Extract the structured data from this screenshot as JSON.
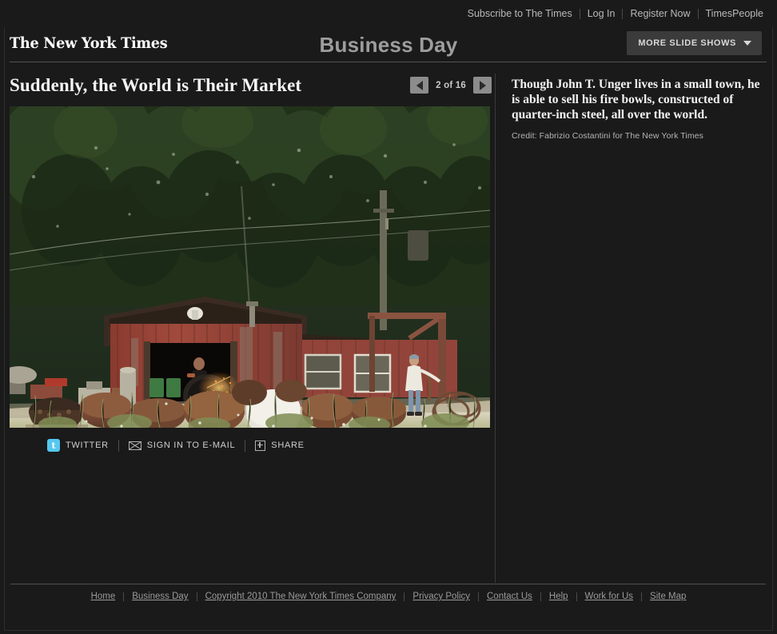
{
  "topbar": {
    "links": [
      {
        "label": "Subscribe to The Times"
      },
      {
        "label": "Log In"
      },
      {
        "label": "Register Now"
      },
      {
        "label": "TimesPeople"
      }
    ]
  },
  "masthead": {
    "logo": "The New York Times",
    "section_title": "Business Day",
    "more_slideshows_label": "MORE SLIDE SHOWS",
    "caret_icon": "chevron-down-icon"
  },
  "slideshow": {
    "headline": "Suddenly, the World is Their Market",
    "prev_icon": "arrow-left-icon",
    "next_icon": "arrow-right-icon",
    "counter": "2 of 16",
    "current_index": 2,
    "total_slides": 16
  },
  "share": {
    "twitter": {
      "label": "TWITTER",
      "icon": "twitter-icon",
      "color": "#55c8f0"
    },
    "email": {
      "label": "SIGN IN TO E-MAIL",
      "icon": "envelope-icon"
    },
    "share": {
      "label": "SHARE",
      "icon": "plus-box-icon"
    }
  },
  "caption": {
    "text": "Though John T. Unger lives in a small town, he is able to sell his fire bowls, constructed of quarter-inch steel, all over the world.",
    "credit": "Credit: Fabrizio Costantini for The New York Times"
  },
  "footer": {
    "links": [
      {
        "label": "Home"
      },
      {
        "label": "Business Day"
      },
      {
        "label": "Copyright 2010 The New York Times Company"
      },
      {
        "label": "Privacy Policy"
      },
      {
        "label": "Contact Us"
      },
      {
        "label": "Help"
      },
      {
        "label": "Work for Us"
      },
      {
        "label": "Site Map"
      }
    ]
  },
  "photo": {
    "alt": "Metalworker cutting steel with sparks inside a weathered red barn, rusted propane tank halves and fire bowls in the sandy yard, man in white shirt standing at right, dense pine forest behind"
  },
  "colors": {
    "background": "#1a1a1a",
    "accent_twitter": "#55c8f0",
    "text_primary": "#f2f2f2",
    "text_muted": "#9a9a9a"
  }
}
